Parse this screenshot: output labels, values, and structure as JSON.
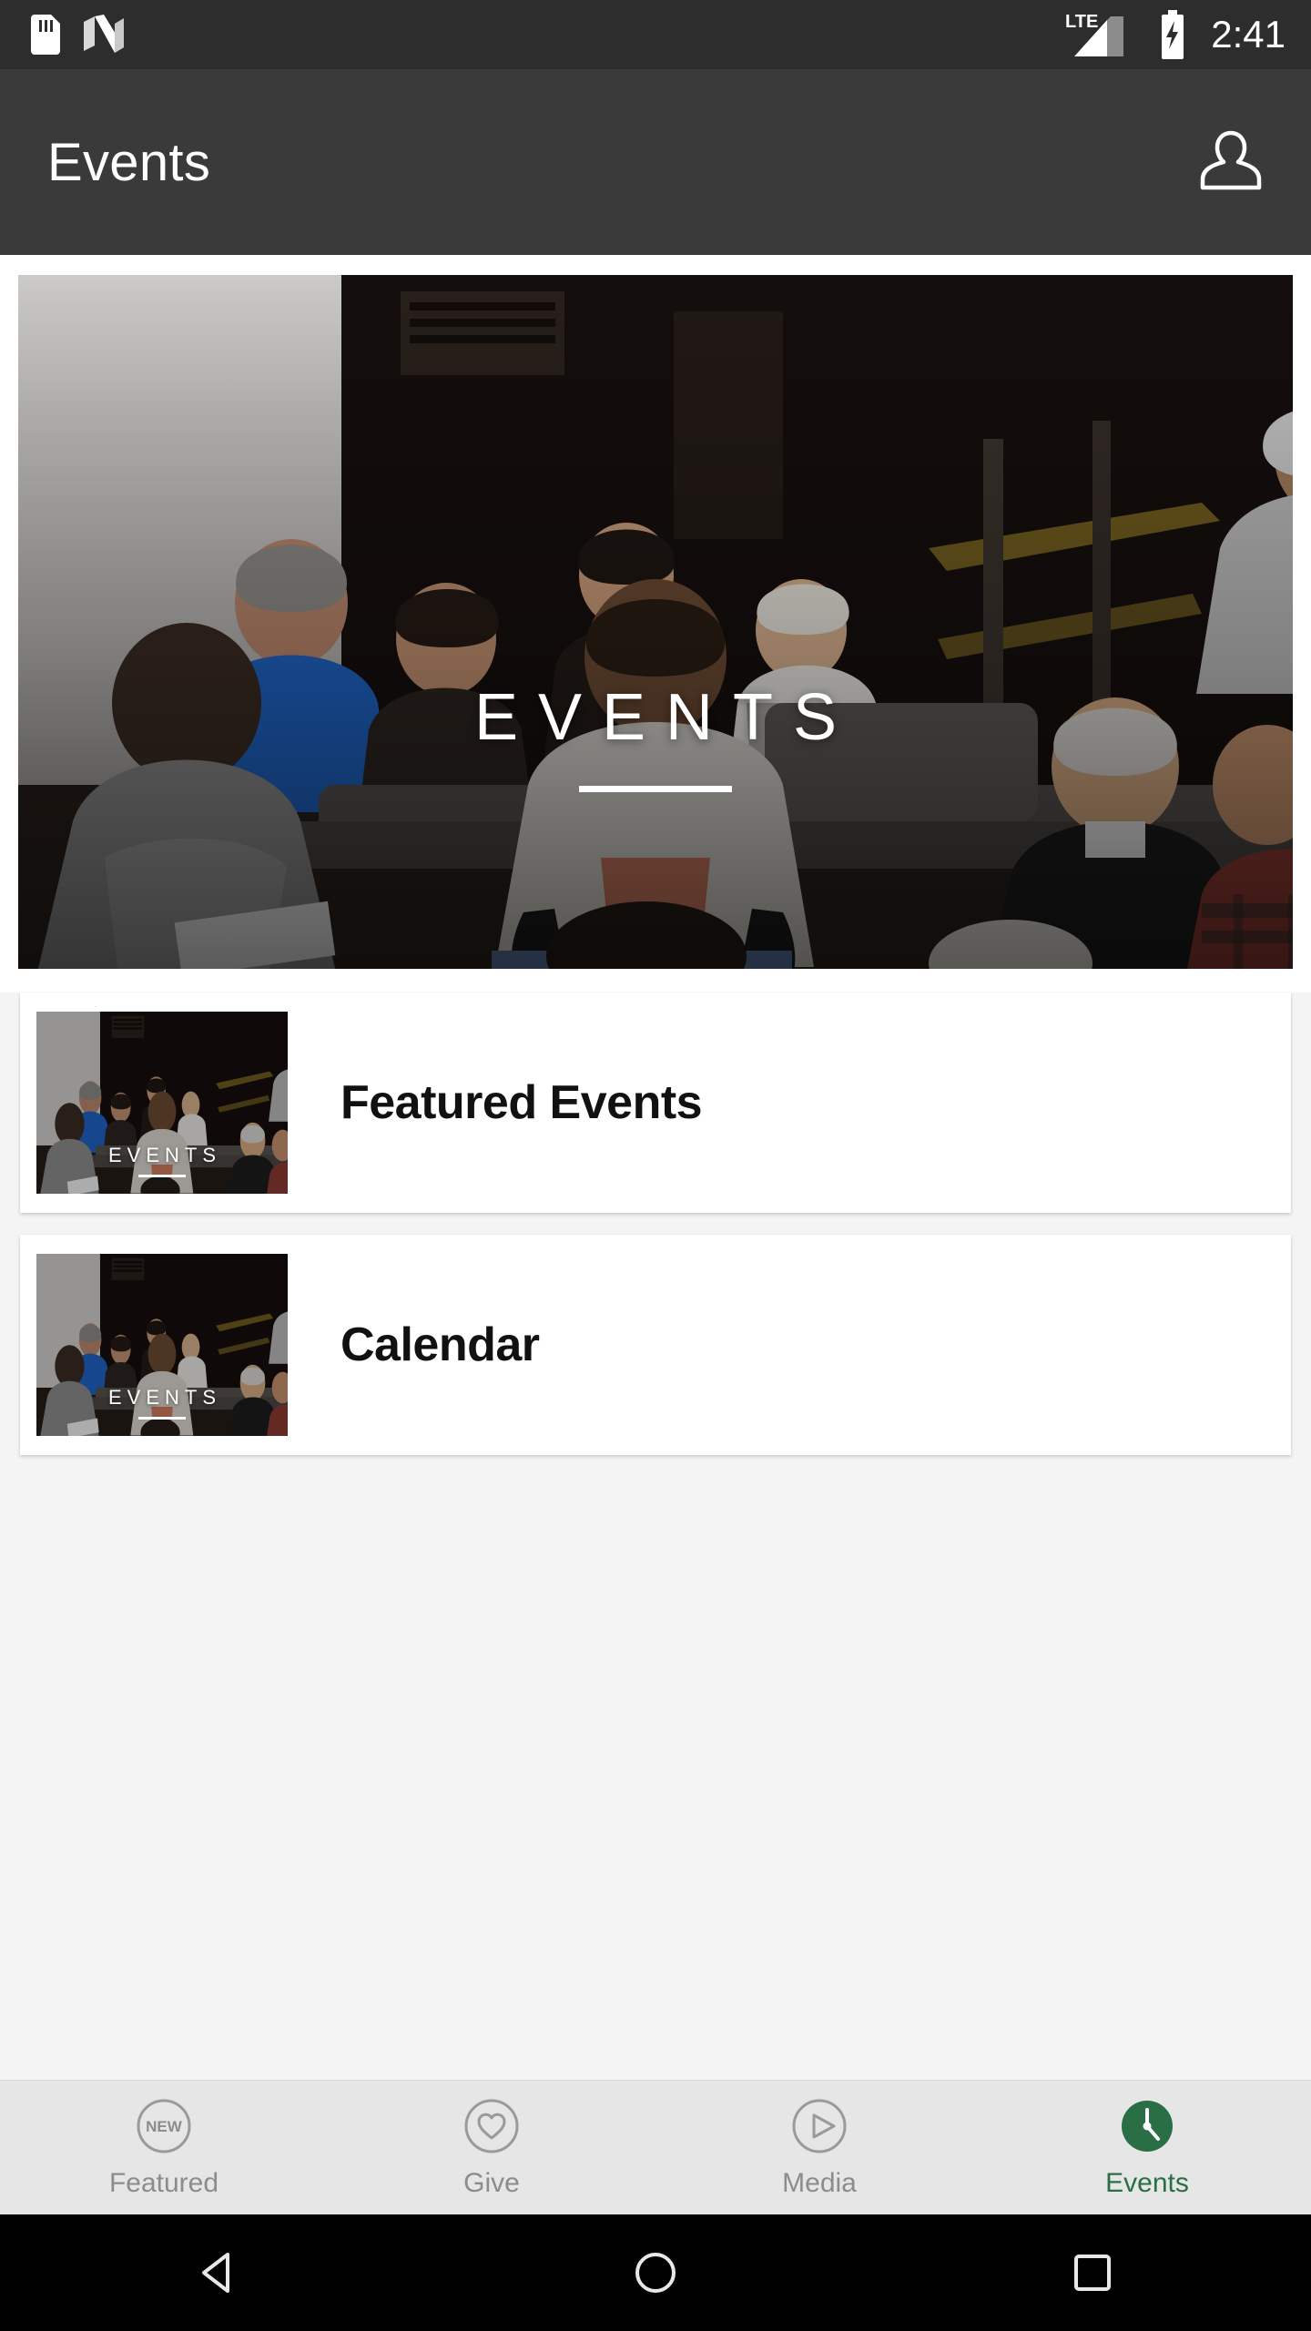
{
  "statusbar": {
    "time": "2:41",
    "icons": [
      "sd-card-icon",
      "nfc-icon",
      "lte-signal-icon",
      "battery-charging-icon"
    ],
    "network_label": "LTE"
  },
  "appbar": {
    "title": "Events",
    "action_icon": "profile-person-icon"
  },
  "hero": {
    "title": "EVENTS",
    "image_alt": "men seated in rows talking in a meeting room"
  },
  "list": {
    "items": [
      {
        "label": "Featured Events",
        "thumb_title": "EVENTS"
      },
      {
        "label": "Calendar",
        "thumb_title": "EVENTS"
      }
    ]
  },
  "tabbar": {
    "active_color": "#2a6e46",
    "inactive_color": "#8c8c8c",
    "tabs": [
      {
        "label": "Featured",
        "icon": "new-badge-circle-icon",
        "badge_text": "NEW",
        "active": false
      },
      {
        "label": "Give",
        "icon": "heart-circle-icon",
        "active": false
      },
      {
        "label": "Media",
        "icon": "play-circle-icon",
        "active": false
      },
      {
        "label": "Events",
        "icon": "clock-circle-filled-icon",
        "active": true
      }
    ]
  },
  "navbar": {
    "buttons": [
      {
        "name": "back-button",
        "icon": "triangle-back-icon"
      },
      {
        "name": "home-button",
        "icon": "circle-home-icon"
      },
      {
        "name": "recents-button",
        "icon": "square-recents-icon"
      }
    ]
  }
}
